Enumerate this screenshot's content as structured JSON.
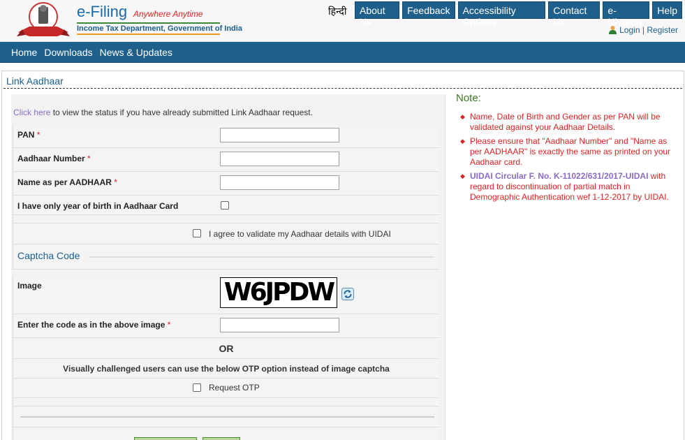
{
  "header": {
    "brand_title": "e-Filing",
    "brand_tagline": "Anywhere Anytime",
    "brand_dept": "Income Tax Department, Government of India",
    "hindi_label": "हिन्दी",
    "top_nav": [
      "About Us",
      "Feedback",
      "Accessibility Options",
      "Contact Us",
      "e-Nivaran",
      "Help"
    ],
    "login_label": "Login",
    "separator": "|",
    "register_label": "Register"
  },
  "main_nav": [
    "Home",
    "Downloads",
    "News & Updates"
  ],
  "page": {
    "title": "Link Aadhaar",
    "status_link": "Click here",
    "status_text": " to view the status if you have already submitted Link Aadhaar request."
  },
  "form": {
    "pan_label": "PAN",
    "aadhaar_label": "Aadhaar Number",
    "name_label": "Name as per AADHAAR",
    "yob_label": "I have only year of birth in Aadhaar Card",
    "agree_label": "I agree to validate my Aadhaar details with UIDAI",
    "required_mark": "*",
    "captcha_legend": "Captcha Code",
    "image_label": "Image",
    "captcha_text": "W6JPDW",
    "enter_code_label": "Enter the code as in the above image",
    "or_text": "OR",
    "visual_text": "Visually challenged users can use the below OTP option instead of image captcha",
    "otp_label": "Request OTP"
  },
  "note": {
    "title": "Note:",
    "item1": "Name, Date of Birth and Gender as per PAN will be validated against your Aadhaar Details.",
    "item2": "Please ensure that \"Aadhaar Number\" and \"Name as per AADHAAR\" is exactly the same as printed on your Aadhaar card.",
    "item3_link": "UIDAI Circular F. No. K-11022/631/2017-UIDAI",
    "item3_text": " with regard to discontinuation of partial match in Demographic Authentication wef 1-12-2017 by UIDAI."
  },
  "colors": {
    "nav_blue": "#1f5f8b",
    "required_red": "#dd2222",
    "note_green": "#3a7a20"
  }
}
